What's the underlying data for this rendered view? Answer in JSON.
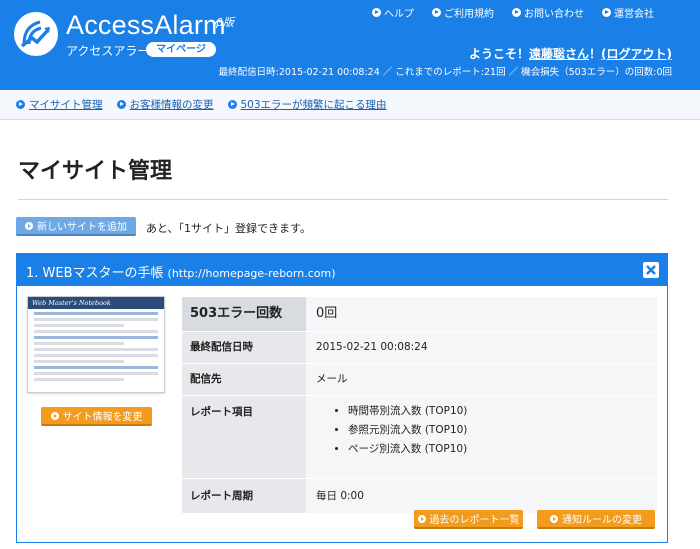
{
  "header": {
    "logo_main": "AccessAlarm",
    "logo_beta": "β版",
    "logo_sub": "アクセスアラーム",
    "logo_badge": "マイページ",
    "links": [
      {
        "label": "ヘルプ"
      },
      {
        "label": "ご利用規約"
      },
      {
        "label": "お問い合わせ"
      },
      {
        "label": "運営会社"
      }
    ],
    "welcome_prefix": "ようこそ！",
    "username": "遠藤聡さん",
    "welcome_mid": "！",
    "logout_label": "(ログアウト)",
    "stats": "最終配信日時:2015-02-21 00:08:24 ／ これまでのレポート:21回 ／ 機会損失（503エラー）の回数:0回"
  },
  "subnav": [
    {
      "label": "マイサイト管理"
    },
    {
      "label": "お客様情報の変更"
    },
    {
      "label": "503エラーが頻繁に起こる理由"
    }
  ],
  "page_title": "マイサイト管理",
  "add_site": {
    "button_label": "新しいサイトを追加",
    "note": "あと、「1サイト」登録できます。"
  },
  "site": {
    "title": "1. WEBマスターの手帳",
    "url": "(http://homepage-reborn.com)",
    "thumbnail_title": "Web Master's Notebook",
    "site_button_label": "サイト情報を変更",
    "info": {
      "errors_label": "503エラー回数",
      "errors_value": "0回",
      "last_sent_label": "最終配信日時",
      "last_sent_value": "2015-02-21 00:08:24",
      "dest_label": "配信先",
      "dest_value": "メール",
      "report_items_label": "レポート項目",
      "report_items": [
        "時間帯別流入数 (TOP10)",
        "参照元別流入数 (TOP10)",
        "ページ別流入数 (TOP10)"
      ],
      "cycle_label": "レポート周期",
      "cycle_value": "毎日 0:00"
    },
    "past_reports_label": "過去のレポート一覧",
    "notify_rules_label": "通知ルールの変更"
  },
  "colors": {
    "header_blue": "#1a7fe6",
    "orange_button": "#f29b1c",
    "light_blue_button": "#6ea9e6"
  }
}
